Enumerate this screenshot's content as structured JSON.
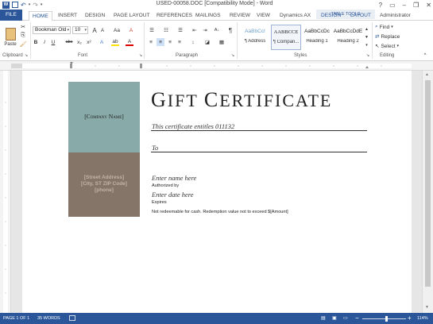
{
  "window": {
    "title": "USED-00058.DOC [Compatibility Mode] - Word",
    "ctrl_help": "?",
    "ctrl_ribbon": "▭",
    "ctrl_min": "–",
    "ctrl_max": "❐",
    "ctrl_close": "✕"
  },
  "tabs": {
    "file": "FILE",
    "home": "HOME",
    "insert": "INSERT",
    "design": "DESIGN",
    "page_layout": "PAGE LAYOUT",
    "references": "REFERENCES",
    "mailings": "MAILINGS",
    "review": "REVIEW",
    "view": "VIEW",
    "dynamics": "Dynamics AX",
    "table_tools": "TABLE TOOLS",
    "tt_design": "DESIGN",
    "tt_layout": "LAYOUT",
    "user": "Administrator"
  },
  "ribbon": {
    "clipboard": {
      "label": "Clipboard",
      "paste": "Paste"
    },
    "font": {
      "label": "Font",
      "family": "Bookman Old",
      "size": "10",
      "bold": "B",
      "italic": "I",
      "underline": "U",
      "strike": "abc",
      "sub": "x₂",
      "sup": "x²",
      "grow": "A",
      "shrink": "A",
      "case": "Aa",
      "clear": "A",
      "highlight": "ab",
      "color": "A"
    },
    "paragraph": {
      "label": "Paragraph",
      "pilcrow": "¶",
      "sort": "A↓"
    },
    "styles": {
      "label": "Styles",
      "items": [
        {
          "preview": "AaBbCcI",
          "name": "¶ Address"
        },
        {
          "preview": "AABBCCE",
          "name": "¶ Compan..."
        },
        {
          "preview": "AaBbCcDc",
          "name": "Heading 1"
        },
        {
          "preview": "AaBbCcDdE",
          "name": "Heading 2"
        }
      ]
    },
    "editing": {
      "label": "Editing",
      "find": "Find",
      "replace": "Replace",
      "select": "Select"
    }
  },
  "certificate": {
    "company": "[Company Name]",
    "street": "[Street Address]",
    "city": "[City, ST  ZIP Code]",
    "phone": "[phone]",
    "title_g": "G",
    "title_ift": "IFT ",
    "title_c": "C",
    "title_ertificate": "ERTIFICATE",
    "entitles": "This certificate entitles 011132",
    "to": "To",
    "enter_name": "Enter name here",
    "authorized": "Authorized by",
    "enter_date": "Enter date here",
    "expires": "Expires",
    "disclaimer": "Not redeemable for cash. Redemption value not to exceed $[Amount]"
  },
  "status": {
    "page": "PAGE 1 OF 1",
    "words": "35 WORDS",
    "zoom": "114%",
    "zoom_minus": "−",
    "zoom_plus": "+"
  },
  "colors": {
    "accent": "#2b579a",
    "teal": "#88aaa9",
    "brown": "#857568"
  }
}
